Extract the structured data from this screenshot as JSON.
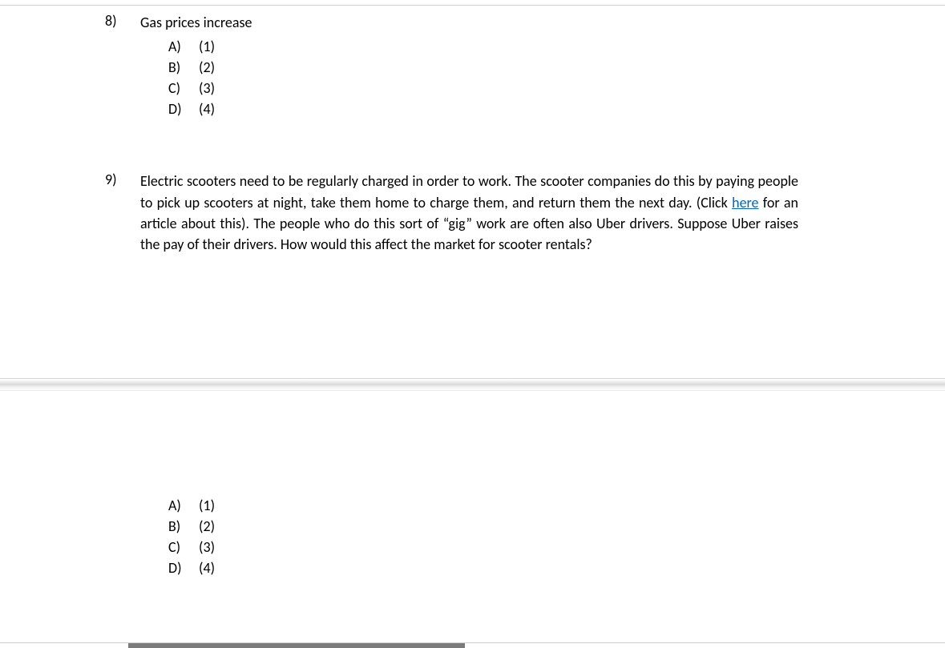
{
  "questions": [
    {
      "number": "8)",
      "text": "Gas prices increase",
      "options": [
        {
          "letter": "A)",
          "value": "(1)"
        },
        {
          "letter": "B)",
          "value": "(2)"
        },
        {
          "letter": "C)",
          "value": "(3)"
        },
        {
          "letter": "D)",
          "value": "(4)"
        }
      ]
    },
    {
      "number": "9)",
      "text_parts": {
        "before_link": "Electric scooters need to be regularly charged in order to work. The scooter companies do this by paying people to pick up scooters at night, take them home to charge them, and return them the next day. (Click ",
        "link": "here",
        "after_link": " for an article about this). The people who do this sort of “gig” work are often also Uber drivers. Suppose Uber raises the pay of their drivers. How would this affect the market for scooter rentals?"
      },
      "options": [
        {
          "letter": "A)",
          "value": "(1)"
        },
        {
          "letter": "B)",
          "value": "(2)"
        },
        {
          "letter": "C)",
          "value": "(3)"
        },
        {
          "letter": "D)",
          "value": "(4)"
        }
      ]
    }
  ]
}
